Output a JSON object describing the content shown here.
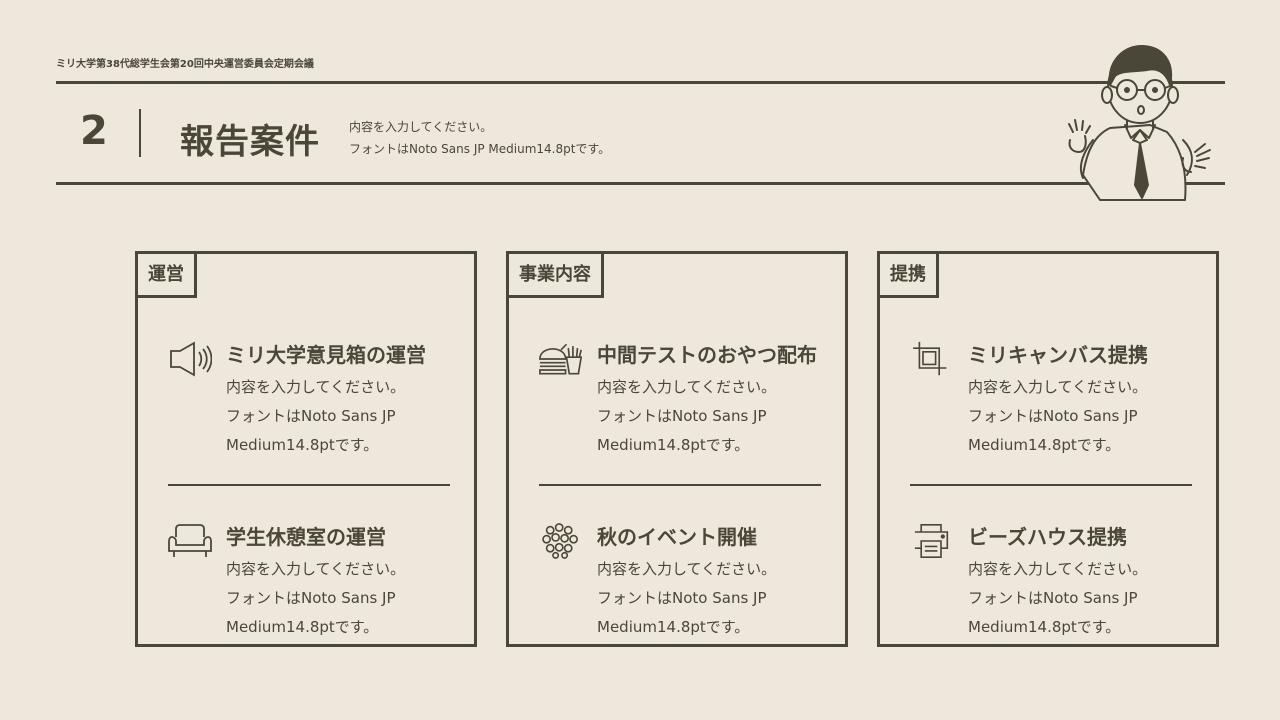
{
  "header": {
    "organization": "ミリ大学第38代総学生会第20回中央運営委員会定期会議",
    "section_number": "2",
    "section_title": "報告案件",
    "description_line1": "内容を入力してください。",
    "description_line2": "フォントはNoto Sans JP Medium14.8ptです。"
  },
  "cards": [
    {
      "tag": "運営",
      "items": [
        {
          "icon": "megaphone-icon",
          "title": "ミリ大学意見箱の運営",
          "desc_line1": "内容を入力してください。",
          "desc_line2": "フォントはNoto Sans JP",
          "desc_line3": "Medium14.8ptです。"
        },
        {
          "icon": "sofa-icon",
          "title": "学生休憩室の運営",
          "desc_line1": "内容を入力してください。",
          "desc_line2": "フォントはNoto Sans JP",
          "desc_line3": "Medium14.8ptです。"
        }
      ]
    },
    {
      "tag": "事業内容",
      "items": [
        {
          "icon": "snacks-icon",
          "title": "中間テストのおやつ配布",
          "desc_line1": "内容を入力してください。",
          "desc_line2": "フォントはNoto Sans JP",
          "desc_line3": "Medium14.8ptです。"
        },
        {
          "icon": "balloons-icon",
          "title": "秋のイベント開催",
          "desc_line1": "内容を入力してください。",
          "desc_line2": "フォントはNoto Sans JP",
          "desc_line3": "Medium14.8ptです。"
        }
      ]
    },
    {
      "tag": "提携",
      "items": [
        {
          "icon": "crop-icon",
          "title": "ミリキャンバス提携",
          "desc_line1": "内容を入力してください。",
          "desc_line2": "フォントはNoto Sans JP",
          "desc_line3": "Medium14.8ptです。"
        },
        {
          "icon": "printer-icon",
          "title": "ビーズハウス提携",
          "desc_line1": "内容を入力してください。",
          "desc_line2": "フォントはNoto Sans JP",
          "desc_line3": "Medium14.8ptです。"
        }
      ]
    }
  ],
  "colors": {
    "background": "#EEE8DC",
    "ink": "#4A4638"
  }
}
